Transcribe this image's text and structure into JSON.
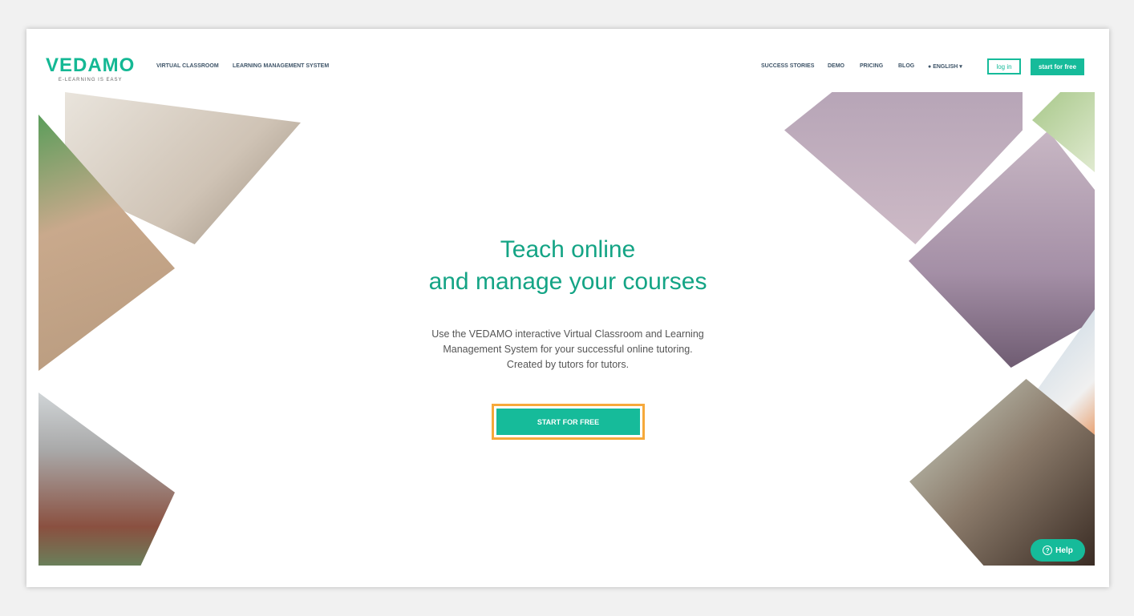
{
  "logo": {
    "name": "VEDAMO",
    "tagline": "E-LEARNING IS EASY"
  },
  "nav_left": [
    "VIRTUAL CLASSROOM",
    "LEARNING MANAGEMENT SYSTEM"
  ],
  "nav_right": [
    "SUCCESS STORIES",
    "DEMO",
    "PRICING",
    "BLOG"
  ],
  "language": {
    "label": "ENGLISH",
    "icon": "globe-icon"
  },
  "login_label": "log in",
  "start_label": "start for free",
  "hero": {
    "title_line1": "Teach online",
    "title_line2": "and manage your courses",
    "desc_line1": "Use the VEDAMO interactive Virtual Classroom and Learning",
    "desc_line2": "Management System for your successful online tutoring.",
    "desc_line3": "Created by tutors for tutors.",
    "cta": "START FOR FREE"
  },
  "help_label": "Help",
  "colors": {
    "accent": "#16bb9a",
    "highlight": "#f6a93b"
  }
}
